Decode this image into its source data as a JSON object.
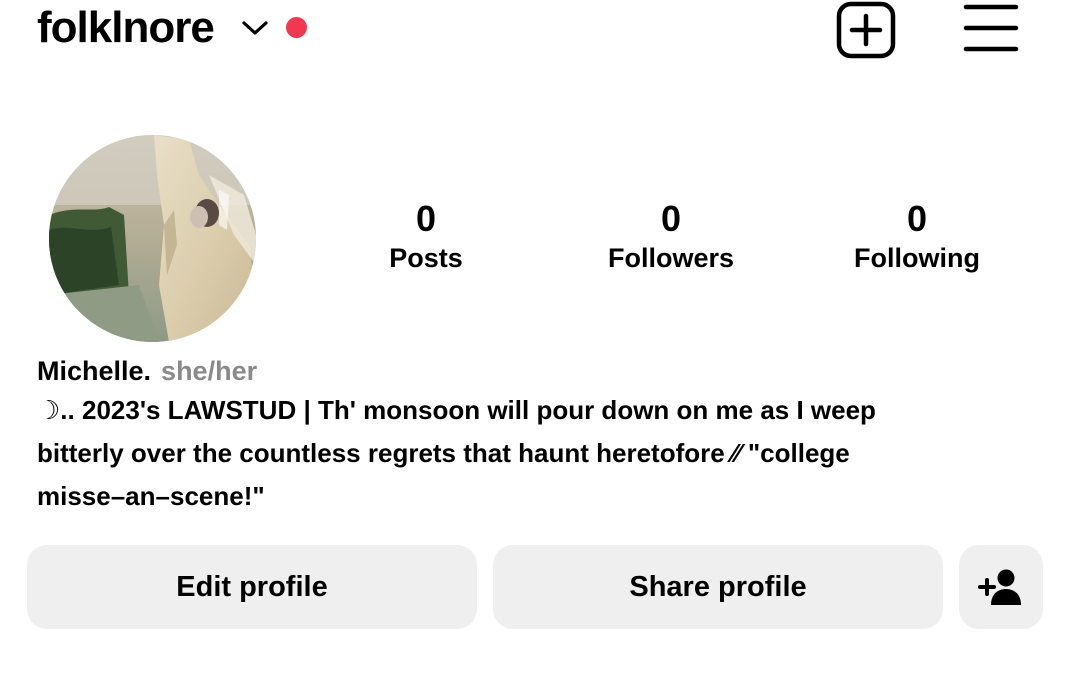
{
  "header": {
    "username": "folklnore",
    "live_dot_color": "#f0394f",
    "icons": {
      "account_switch": "chevron-down-icon",
      "new_post": "plus-square-icon",
      "menu": "hamburger-menu-icon"
    }
  },
  "profile": {
    "avatar_icon": "profile-photo",
    "stats": [
      {
        "value": "0",
        "label": "Posts"
      },
      {
        "value": "0",
        "label": "Followers"
      },
      {
        "value": "0",
        "label": "Following"
      }
    ],
    "display_name": "Michelle.",
    "pronouns": "she/her",
    "bio_lines": [
      "☽.. 2023's LAWSTUD | Th' monsoon will pour down on me as I weep",
      "bitterly over the countless regrets that haunt heretofore ⁄⁄ \"college",
      "misse–an–scene!\""
    ]
  },
  "actions": {
    "edit_profile": "Edit profile",
    "share_profile": "Share profile",
    "discover_people_icon": "add-person-icon"
  },
  "colors": {
    "button_bg": "#efefef",
    "pronoun_gray": "#8a8a8a",
    "text": "#000000"
  }
}
